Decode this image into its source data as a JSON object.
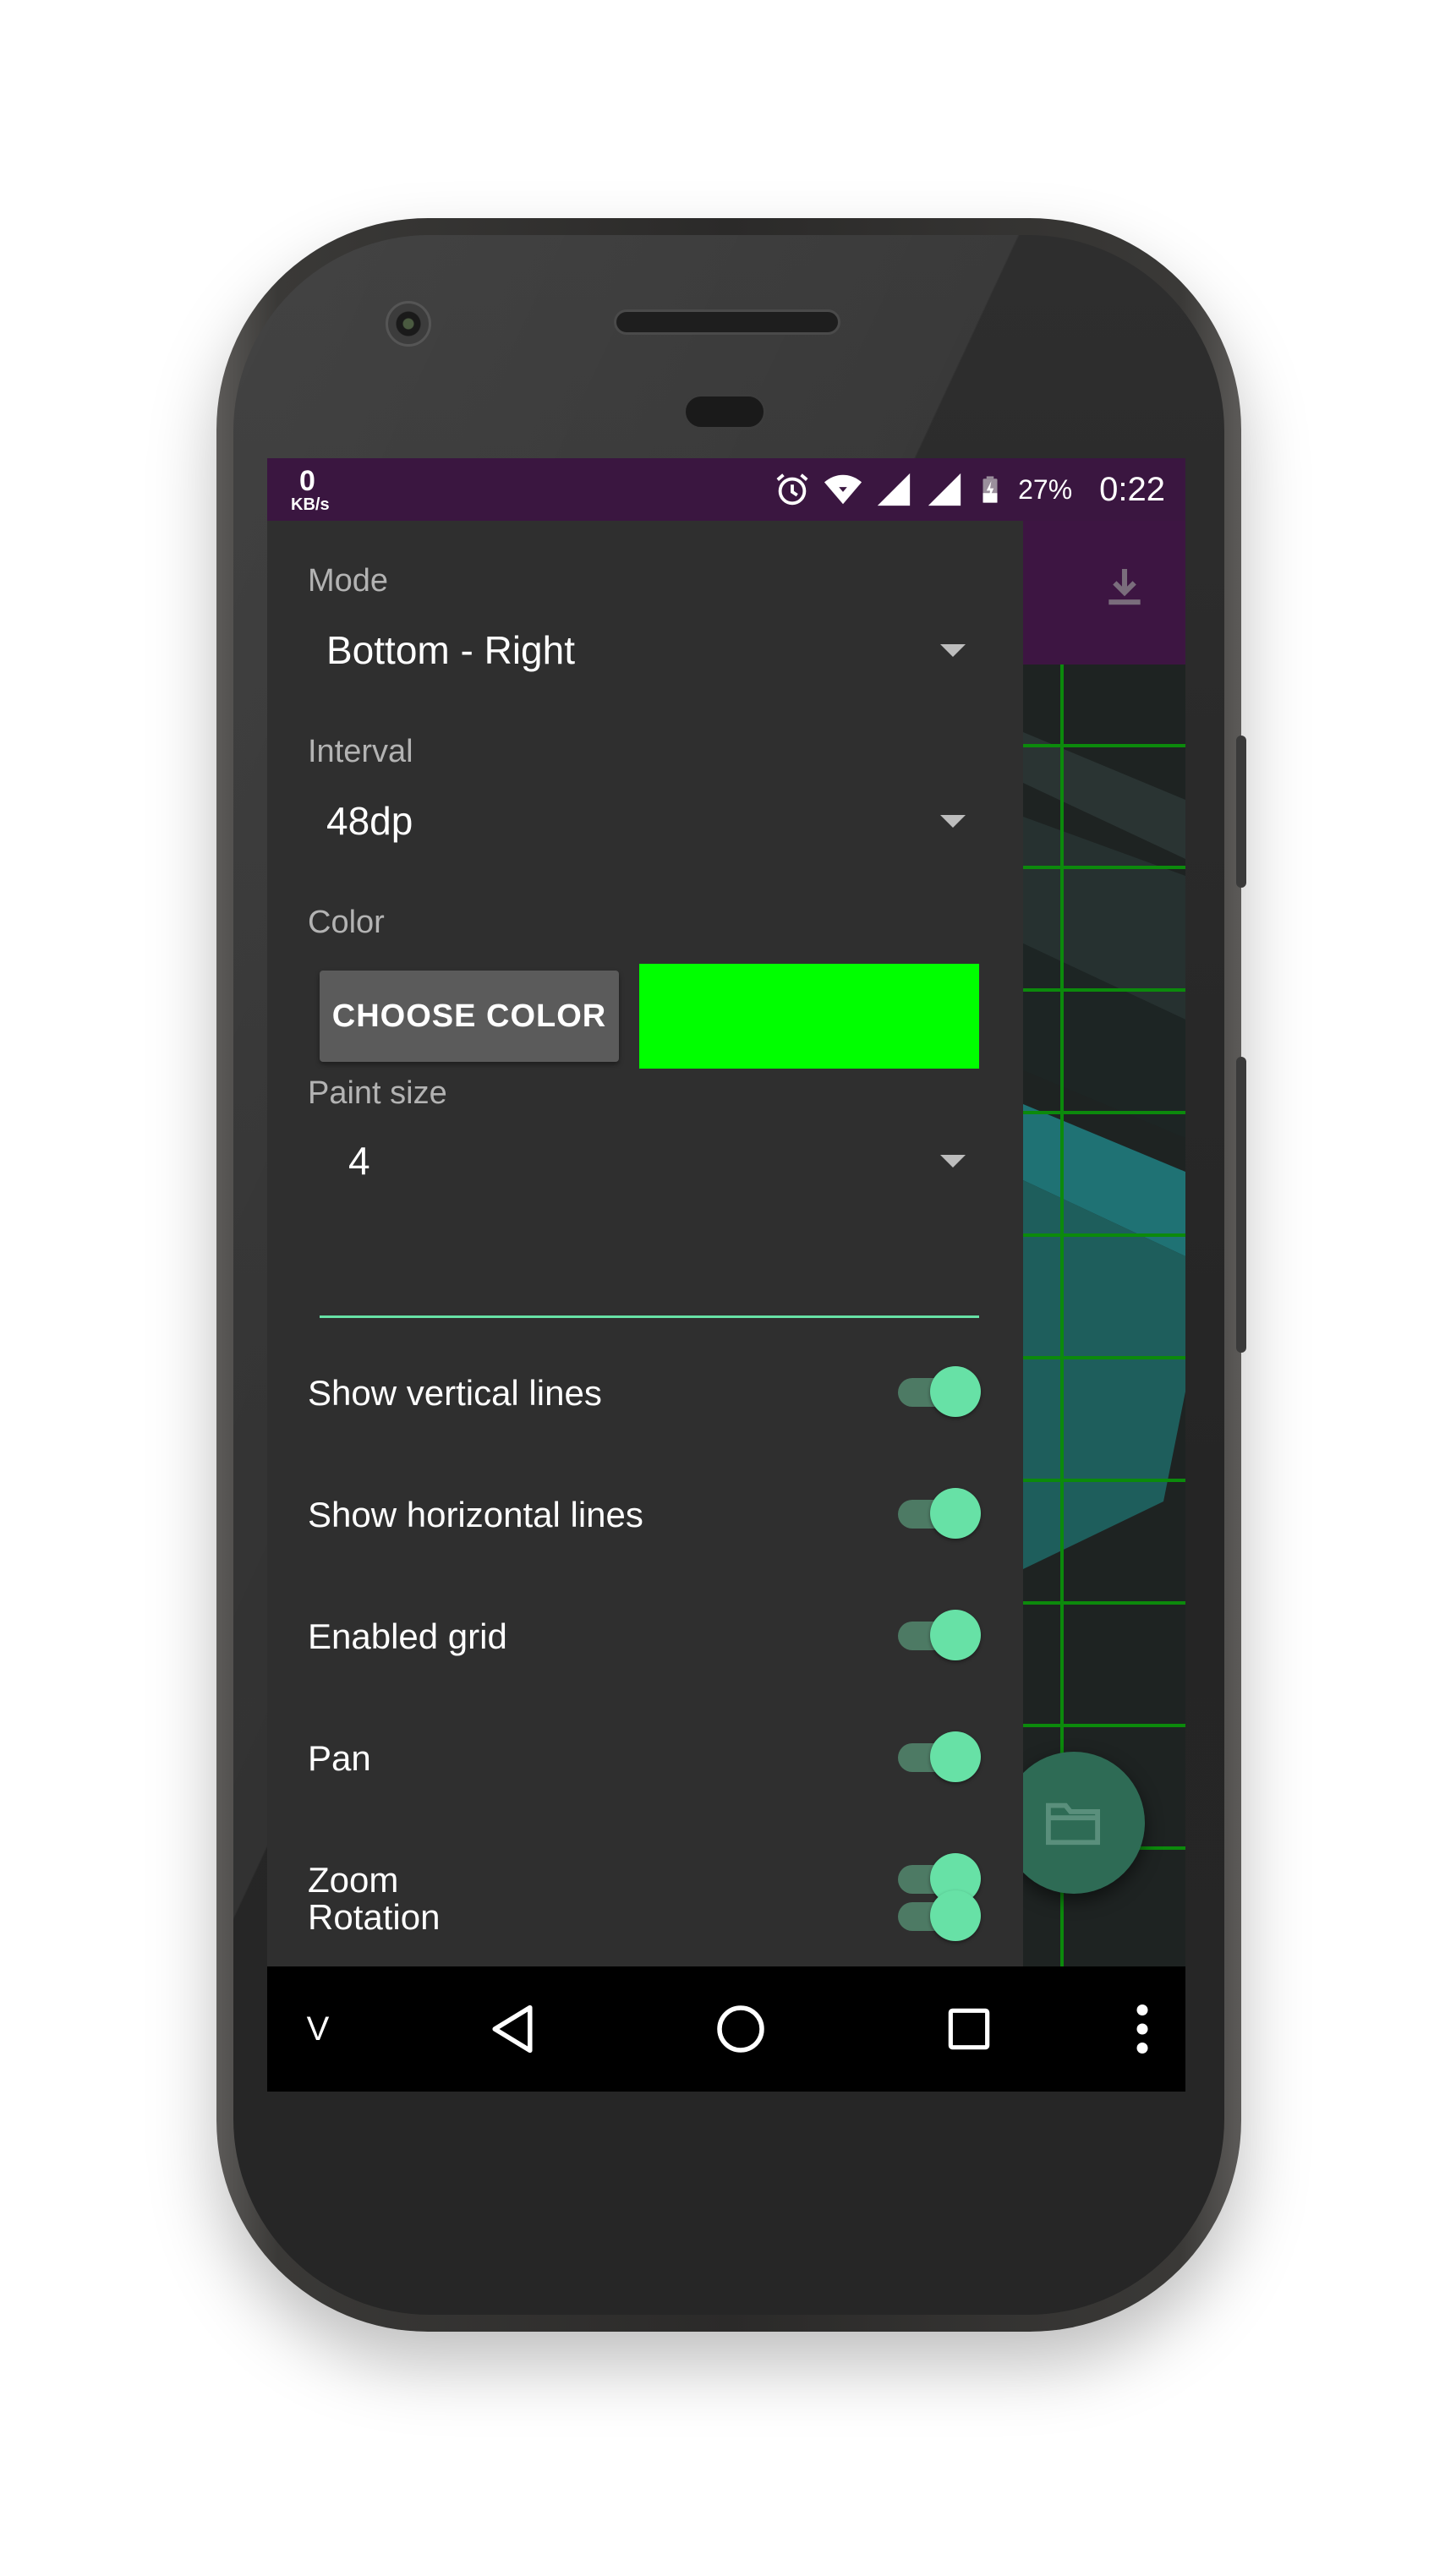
{
  "status_bar": {
    "net_speed_value": "0",
    "net_speed_unit": "KB/s",
    "battery_percent": "27%",
    "time": "0:22",
    "icons": [
      "alarm-icon",
      "wifi-icon",
      "signal-icon",
      "signal-icon",
      "battery-charging-icon"
    ]
  },
  "app": {
    "toolbar_icon": "download-icon",
    "fab_icon": "folder-icon",
    "colors": {
      "toolbar": "#3d1542",
      "status_bar": "#3a1640",
      "accent": "#67e1a6",
      "grid": "#0f8a0f"
    }
  },
  "drawer": {
    "mode": {
      "label": "Mode",
      "value": "Bottom - Right"
    },
    "interval": {
      "label": "Interval",
      "value": "48dp"
    },
    "color": {
      "label": "Color",
      "button_label": "CHOOSE COLOR",
      "swatch": "#00ff00"
    },
    "paint_size": {
      "label": "Paint size",
      "value": "4"
    },
    "switches": [
      {
        "label": "Show vertical lines",
        "on": true
      },
      {
        "label": "Show horizontal lines",
        "on": true
      },
      {
        "label": "Enabled grid",
        "on": true
      },
      {
        "label": "Pan",
        "on": true
      },
      {
        "label": "Zoom",
        "on": true
      },
      {
        "label": "Rotation",
        "on": true
      }
    ]
  },
  "nav_bar": {
    "left_label": "V",
    "buttons": [
      "back-icon",
      "home-icon",
      "recents-icon",
      "overflow-menu-icon"
    ]
  }
}
